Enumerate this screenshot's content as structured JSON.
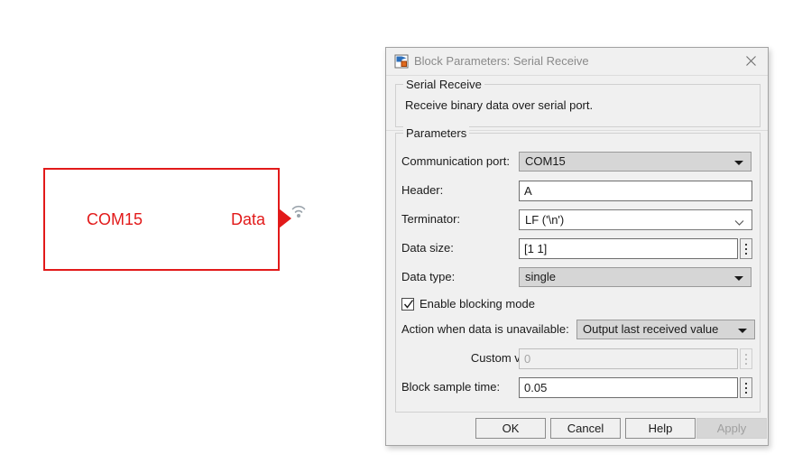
{
  "canvas": {
    "block": {
      "name": "serial-receive-block",
      "input_label": "COM15",
      "output_label": "Data",
      "outline_color": "#e21a1a",
      "text_color": "#e21a1a"
    }
  },
  "dialog": {
    "title": "Block Parameters: Serial Receive",
    "icon": "block-parameters-icon",
    "close_icon": "close-icon",
    "description_group": {
      "legend": "Serial Receive",
      "text": "Receive binary data over serial port."
    },
    "parameters_group": {
      "legend": "Parameters",
      "fields": {
        "communication_port": {
          "label": "Communication port:",
          "value": "COM15"
        },
        "header": {
          "label": "Header:",
          "value": "A"
        },
        "terminator": {
          "label": "Terminator:",
          "value": "LF ('\\n')"
        },
        "data_size": {
          "label": "Data size:",
          "value": "[1  1]"
        },
        "data_type": {
          "label": "Data type:",
          "value": "single"
        },
        "enable_blocking_mode": {
          "label": "Enable blocking mode",
          "checked": true
        },
        "action_when_unavailable": {
          "label": "Action when data is unavailable:",
          "value": "Output last received value"
        },
        "custom_value": {
          "label": "Custom value:",
          "value": "0",
          "enabled": false
        },
        "block_sample_time": {
          "label": "Block sample time:",
          "value": "0.05"
        }
      }
    },
    "buttons": {
      "ok": "OK",
      "cancel": "Cancel",
      "help": "Help",
      "apply": "Apply"
    }
  }
}
